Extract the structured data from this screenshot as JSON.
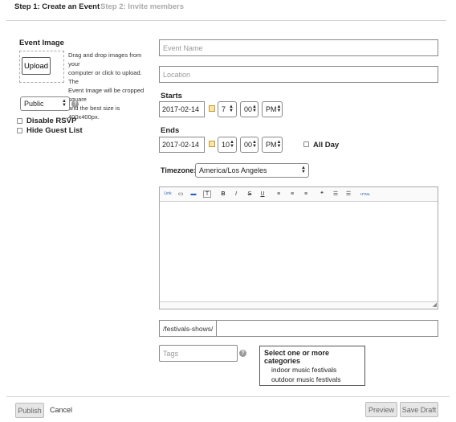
{
  "tabs": {
    "step1": "Step 1: Create an Event",
    "step2": "Step 2: Invite members"
  },
  "image": {
    "title": "Event Image",
    "upload_label": "Upload",
    "help_lines": [
      "Drag and drop images from your",
      "computer or click to upload. The",
      "Event Image will be cropped square",
      "and the best size is 400x400px."
    ]
  },
  "privacy": {
    "selected": "Public",
    "help": "?"
  },
  "options": {
    "disable_rsvp": "Disable RSVP",
    "hide_guest_list": "Hide Guest List"
  },
  "fields": {
    "event_name_placeholder": "Event Name",
    "location_placeholder": "Location"
  },
  "starts": {
    "label": "Starts",
    "date": "2017-02-14",
    "hour": "7",
    "minute": "00",
    "ampm": "PM"
  },
  "ends": {
    "label": "Ends",
    "date": "2017-02-14",
    "hour": "10",
    "minute": "00",
    "ampm": "PM",
    "all_day": "All Day"
  },
  "timezone": {
    "label": "Timezone:",
    "value": "America/Los Angeles"
  },
  "editor": {
    "toolbar": [
      {
        "icon": "link-icon",
        "glyph": "Link"
      },
      {
        "icon": "image-icon",
        "glyph": "▭"
      },
      {
        "icon": "media-icon",
        "glyph": "▬"
      },
      {
        "icon": "paste-text-icon",
        "glyph": "T"
      },
      {
        "icon": "bold-icon",
        "glyph": "B"
      },
      {
        "icon": "italic-icon",
        "glyph": "I"
      },
      {
        "icon": "strikethrough-icon",
        "glyph": "S"
      },
      {
        "icon": "underline-icon",
        "glyph": "U"
      },
      {
        "icon": "align-left-icon",
        "glyph": "≡"
      },
      {
        "icon": "align-center-icon",
        "glyph": "≡"
      },
      {
        "icon": "align-right-icon",
        "glyph": "≡"
      },
      {
        "icon": "blockquote-icon",
        "glyph": "❝"
      },
      {
        "icon": "bullet-list-icon",
        "glyph": "☰"
      },
      {
        "icon": "numbered-list-icon",
        "glyph": "☰"
      },
      {
        "icon": "html-icon",
        "glyph": "HTML"
      }
    ],
    "resize_glyph": "◢"
  },
  "url": {
    "prefix": "/festivals-shows/",
    "slug": ""
  },
  "tags": {
    "placeholder": "Tags",
    "help": "?"
  },
  "categories": {
    "title": "Select one or more categories",
    "items": [
      "indoor music festivals",
      "outdoor music festivals"
    ]
  },
  "footer": {
    "publish": "Publish",
    "cancel": "Cancel",
    "preview": "Preview",
    "save_draft": "Save Draft"
  },
  "colors": {
    "border": "#888888",
    "muted_text": "#999999",
    "button_bg": "#e6e6e6"
  }
}
